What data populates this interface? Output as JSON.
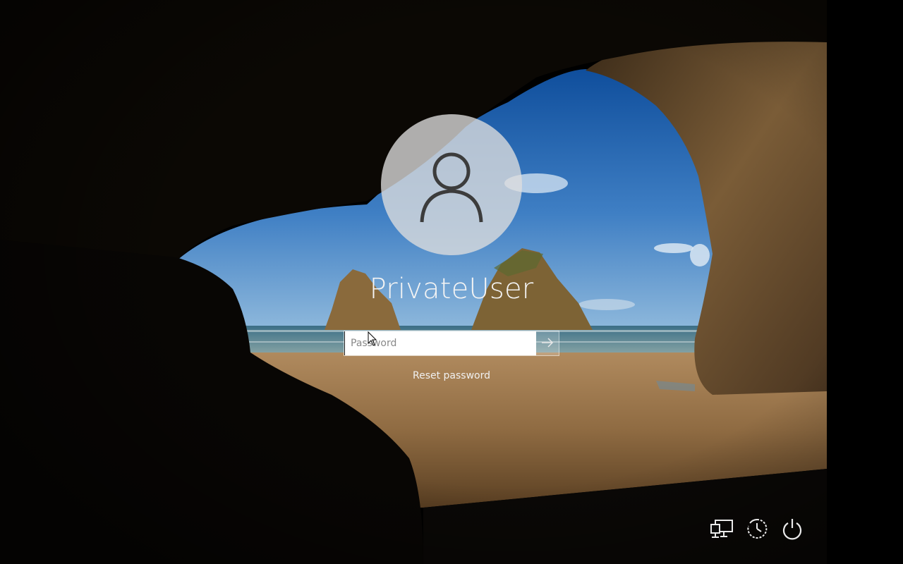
{
  "login": {
    "username": "PrivateUser",
    "password_placeholder": "Password",
    "password_value": "",
    "reset_password_label": "Reset password"
  },
  "icons": {
    "avatar": "user-silhouette-icon",
    "submit": "arrow-right-icon",
    "network": "network-icon",
    "ease_of_access": "ease-of-access-icon",
    "power": "power-icon"
  },
  "colors": {
    "text": "#f4f4f4",
    "avatar_bg": "#dedede",
    "sky": "#2f6db5",
    "sand": "#8a6a44",
    "rock": "#6e5331"
  }
}
